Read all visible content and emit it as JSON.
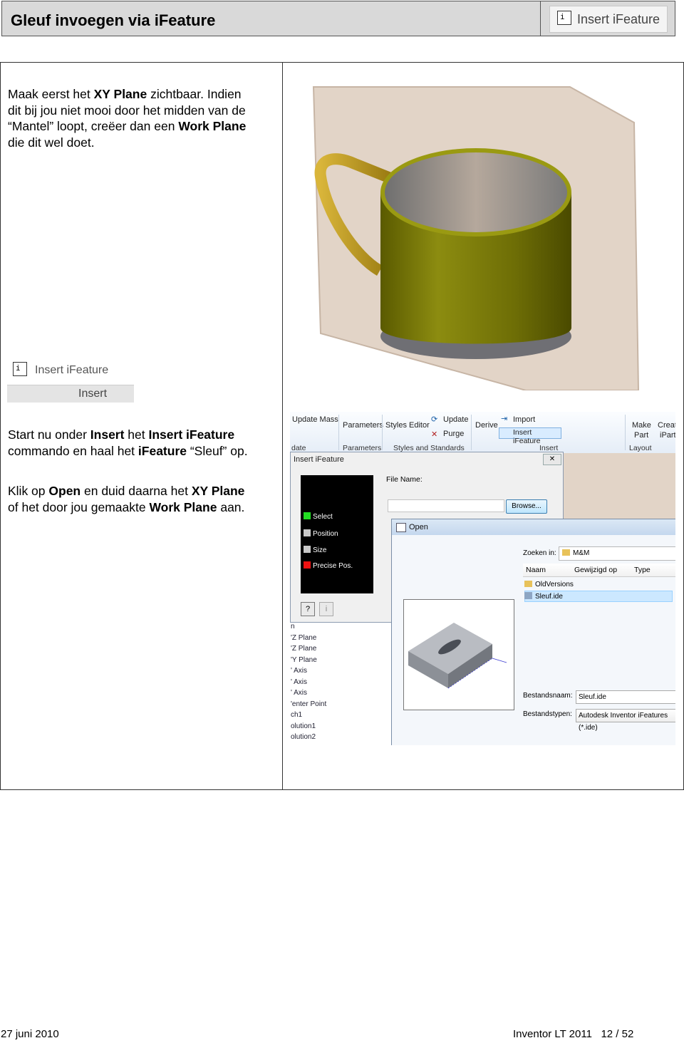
{
  "header": {
    "title": "Gleuf invoegen via iFeature",
    "button_label": "Insert iFeature"
  },
  "step1": {
    "line1_a": "Maak eerst het ",
    "line1_b": "XY Plane",
    "line1_c": " zichtbaar. Indien",
    "line2": "dit bij jou niet mooi door het midden van de",
    "line3_a": "“Mantel” loopt, creëer dan een ",
    "line3_b": "Work Plane",
    "line4": "die dit wel doet."
  },
  "mini_icon": {
    "label": "Insert iFeature",
    "tab": "Insert"
  },
  "step2": {
    "a": "Start nu onder ",
    "b": "Insert",
    "c": " het ",
    "d": "Insert iFeature",
    "e": "commando en haal het ",
    "f": "iFeature",
    "g": " “Sleuf” op."
  },
  "step3": {
    "a": "Klik op ",
    "b": "Open",
    "c": " en duid daarna het ",
    "d": "XY Plane",
    "e": "of het door jou gemaakte ",
    "f": "Work Plane",
    "g": " aan."
  },
  "screenshot": {
    "ribbon": {
      "update_mass": "Update Mass",
      "parameters": "Parameters",
      "styles_editor": "Styles Editor",
      "update": "Update",
      "purge": "Purge",
      "derive": "Derive",
      "import": "Import",
      "insert_ifeature": "Insert iFeature",
      "make_part_1": "Make",
      "make_part_2": "Part",
      "create_ipart_1": "Creat",
      "create_ipart_2": "iPart",
      "grp_update": "date",
      "grp_parameters": "Parameters",
      "grp_styles": "Styles and Standards",
      "grp_insert": "Insert",
      "grp_layout": "Layout"
    },
    "insert_dialog": {
      "title": "Insert iFeature",
      "close": "✕",
      "steps": [
        "Select",
        "Position",
        "Size",
        "Precise Pos."
      ],
      "step_colors": [
        "#22dd22",
        "#c8c8c8",
        "#c8c8c8",
        "#ee1111"
      ],
      "file_name_label": "File Name:",
      "browse": "Browse..."
    },
    "tree": [
      "n",
      "'Z Plane",
      "'Z Plane",
      "'Y Plane",
      "' Axis",
      "' Axis",
      "' Axis",
      "'enter Point",
      "ch1",
      "olution1",
      "olution2"
    ],
    "open_dialog": {
      "title": "Open",
      "look_in_label": "Zoeken in:",
      "look_in_value": "M&M",
      "col_name": "Naam",
      "col_modified": "Gewijzigd op",
      "col_type": "Type",
      "files": [
        "OldVersions",
        "Sleuf.ide"
      ],
      "filename_label": "Bestandsnaam:",
      "filename_value": "Sleuf.ide",
      "filetype_label": "Bestandstypen:",
      "filetype_value": "Autodesk Inventor iFeatures (*.ide)"
    }
  },
  "footer": {
    "date": "27 juni 2010",
    "product": "Inventor LT 2011",
    "page": "12 / 52"
  }
}
